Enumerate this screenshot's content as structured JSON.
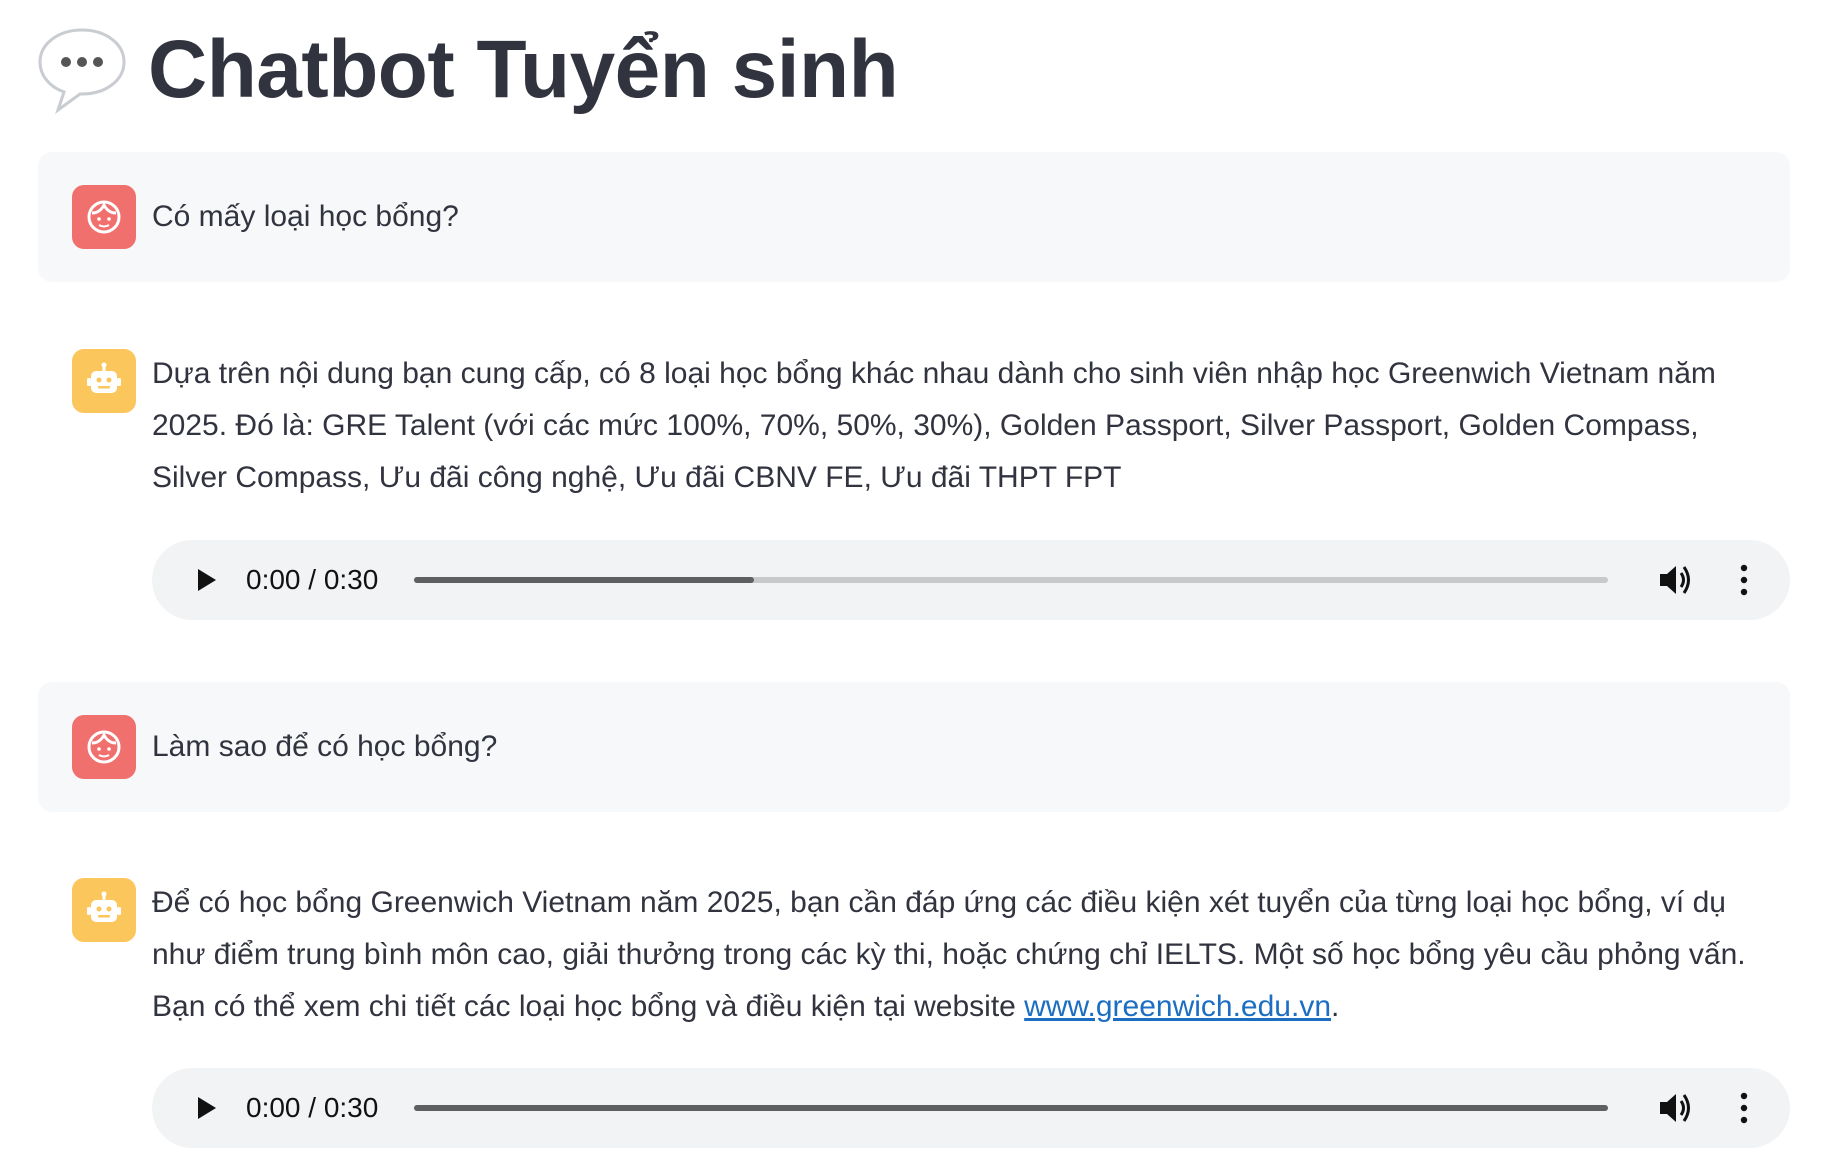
{
  "page": {
    "title": "Chatbot Tuyển sinh",
    "title_icon": "speech-bubble-icon"
  },
  "messages": [
    {
      "role": "user",
      "avatar_icon": "user-face-icon",
      "text": "Có mấy loại học bổng?"
    },
    {
      "role": "assistant",
      "avatar_icon": "robot-icon",
      "text": "Dựa trên nội dung bạn cung cấp, có 8 loại học bổng khác nhau dành cho sinh viên nhập học Greenwich Vietnam năm 2025. Đó là: GRE Talent (với các mức 100%, 70%, 50%, 30%), Golden Passport, Silver Passport, Golden Compass, Silver Compass, Ưu đãi công nghệ, Ưu đãi CBNV FE, Ưu đãi THPT FPT",
      "audio": {
        "time": "0:00 / 0:30",
        "progress": 0.285
      }
    },
    {
      "role": "user",
      "avatar_icon": "user-face-icon",
      "text": "Làm sao để có học bổng?"
    },
    {
      "role": "assistant",
      "avatar_icon": "robot-icon",
      "text_before_link": "Để có học bổng Greenwich Vietnam năm 2025, bạn cần đáp ứng các điều kiện xét tuyển của từng loại học bổng, ví dụ như điểm trung bình môn cao, giải thưởng trong các kỳ thi, hoặc chứng chỉ IELTS. Một số học bổng yêu cầu phỏng vấn. Bạn có thể xem chi tiết các loại học bổng và điều kiện tại website ",
      "link_text": "www.greenwich.edu.vn",
      "text_after_link": ".",
      "audio": {
        "time": "0:00 / 0:30",
        "progress": 1.0
      }
    }
  ],
  "colors": {
    "user_avatar": "#f0706e",
    "bot_avatar": "#fbc65b",
    "user_bubble": "#f7f8fa",
    "link": "#1b6ec2",
    "audio_bg": "#f1f3f4"
  },
  "audio_controls": {
    "play_icon": "play-icon",
    "volume_icon": "volume-icon",
    "menu_icon": "more-vertical-icon"
  }
}
